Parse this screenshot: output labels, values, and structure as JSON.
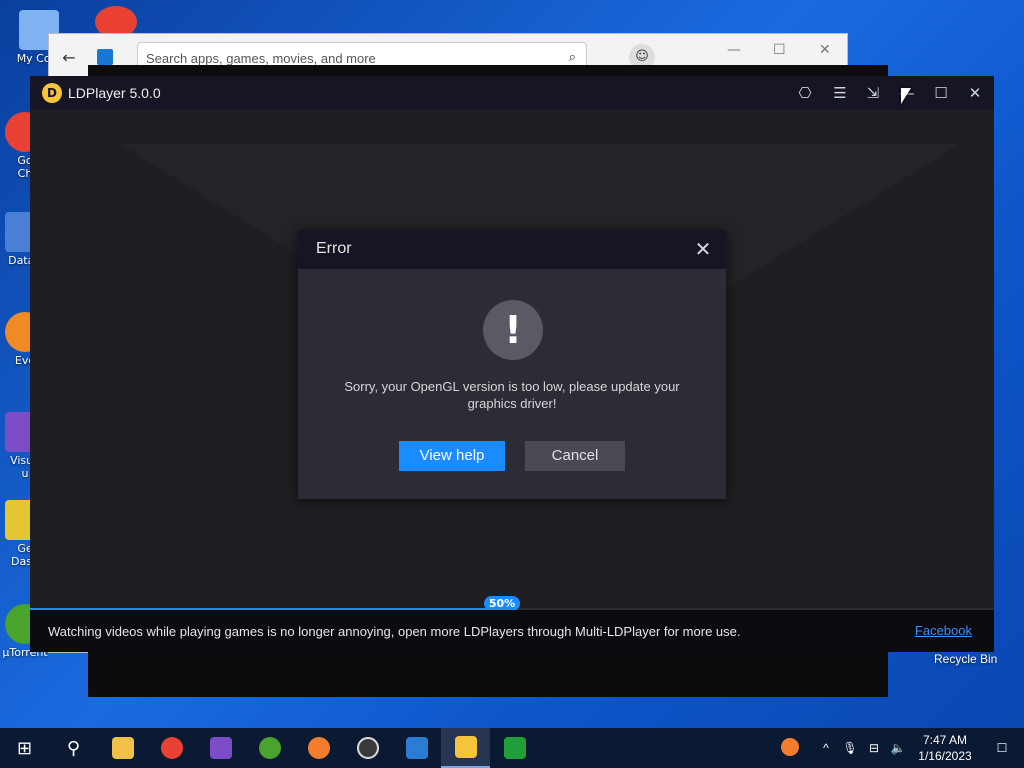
{
  "desktop": {
    "icons": [
      {
        "label": "My Com",
        "color": "#7fb2f0"
      },
      {
        "label": "Go\nCh",
        "color": "#e94235"
      },
      {
        "label": "DataV",
        "color": "#4a7fd4"
      },
      {
        "label": "Eve",
        "color": "#f08a24"
      },
      {
        "label": "Visua\nu",
        "color": "#7d4cc7"
      },
      {
        "label": "Ge\nDash",
        "color": "#e4c632"
      },
      {
        "label": "µTorrent",
        "color": "#4aa32c"
      }
    ],
    "recycle_bin": "Recycle Bin"
  },
  "store_window": {
    "search_placeholder": "Search apps, games, movies, and more",
    "back_icon": "←",
    "search_icon": "⌕",
    "user_icon": "☺",
    "min_icon": "—",
    "max_icon": "☐",
    "close_icon": "✕"
  },
  "ldplayer": {
    "title": "LDPlayer 5.0.0",
    "logo_glyph": "D",
    "progress": 0.5,
    "progress_label": "50%",
    "footer_message": "Watching videos while playing games is no longer annoying, open more LDPlayers through Multi-LDPlayer for more use.",
    "footer_link": "Facebook",
    "toolbar": {
      "gamepad_icon": "⎔",
      "menu_icon": "☰",
      "restore_icon": "⇲",
      "min_icon": "—",
      "max_icon": "☐",
      "close_icon": "✕"
    }
  },
  "error_dialog": {
    "title": "Error",
    "close_icon": "✕",
    "warning_glyph": "!",
    "message": "Sorry, your OpenGL version is too low, please update your graphics driver!",
    "primary_label": "View help",
    "secondary_label": "Cancel"
  },
  "taskbar": {
    "start_icon": "⊞",
    "search_icon": "⚲",
    "apps": [
      {
        "name": "file-explorer",
        "color": "#f0c04a"
      },
      {
        "name": "chrome",
        "color": "#e94235"
      },
      {
        "name": "visual-studio",
        "color": "#7d4cc7"
      },
      {
        "name": "utorrent",
        "color": "#4aa32c"
      },
      {
        "name": "brave",
        "color": "#f37d2c"
      },
      {
        "name": "obs",
        "color": "#3a3a3a"
      },
      {
        "name": "store",
        "color": "#2b7cd3"
      },
      {
        "name": "ldplayer",
        "color": "#f6c43a"
      },
      {
        "name": "xbox",
        "color": "#1f9e3a"
      }
    ],
    "tray": {
      "caret": "^",
      "mic": "🎙",
      "network": "⊟",
      "volume": "🔈",
      "time": "7:47 AM",
      "date": "1/16/2023",
      "notifications": "☐"
    }
  }
}
